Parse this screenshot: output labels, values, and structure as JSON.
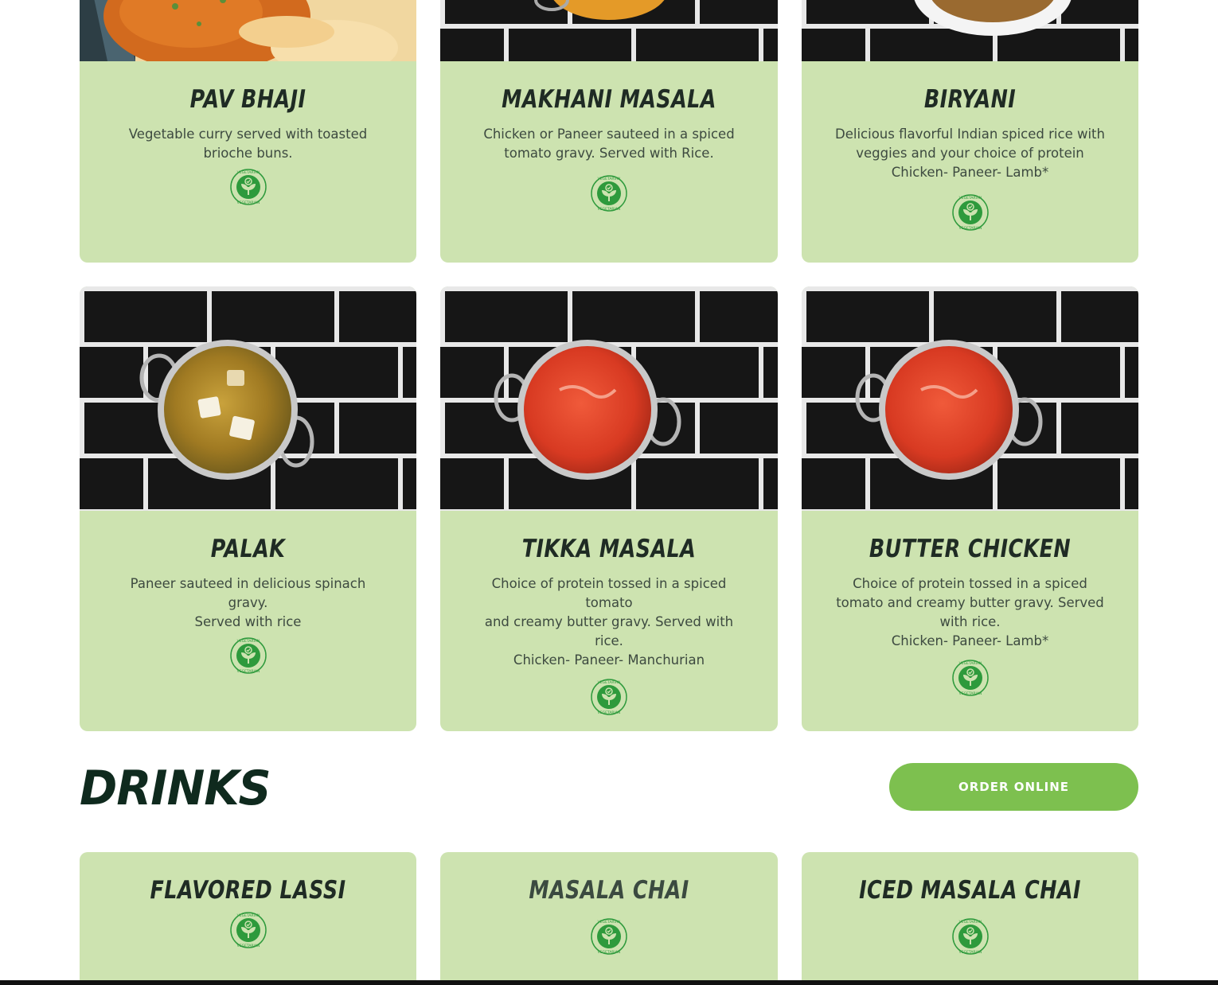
{
  "menu_items": [
    {
      "title": "PAV BHAJI",
      "desc": "Vegetable curry served with toasted\nbrioche buns.",
      "badge": "VEGETARIAN"
    },
    {
      "title": "MAKHANI MASALA",
      "desc": "Chicken or Paneer sauteed in a spiced\ntomato gravy. Served with Rice.",
      "badge": "VEGETARIAN"
    },
    {
      "title": "BIRYANI",
      "desc": "Delicious flavorful Indian spiced rice with\nveggies and your choice of protein\nChicken- Paneer- Lamb*",
      "badge": "VEGETARIAN"
    },
    {
      "title": "PALAK",
      "desc": "Paneer sauteed in delicious spinach gravy.\nServed with rice",
      "badge": "VEGETARIAN"
    },
    {
      "title": "TIKKA MASALA",
      "desc": "Choice of protein tossed in a spiced tomato\nand creamy butter gravy. Served with rice.\nChicken- Paneer- Manchurian",
      "badge": "VEGETARIAN"
    },
    {
      "title": "BUTTER CHICKEN",
      "desc": "Choice of protein tossed in a spiced\ntomato and creamy butter gravy. Served\nwith rice.\nChicken- Paneer- Lamb*",
      "badge": "VEGETARIAN"
    }
  ],
  "drinks": {
    "heading": "DRINKS",
    "order_button": "ORDER ONLINE",
    "items": [
      {
        "title": "FLAVORED LASSI",
        "badge": "VEGETARIAN"
      },
      {
        "title": "MASALA CHAI",
        "badge": "VEGETARIAN"
      },
      {
        "title": "ICED MASALA CHAI",
        "badge": "VEGETARIAN"
      }
    ]
  },
  "colors": {
    "card_bg": "#cde3b0",
    "button_bg": "#7dc04f",
    "heading": "#0f2a1e",
    "badge_green": "#2e9a3c"
  },
  "images": {
    "pav_bhaji": "curry-and-bread-photo",
    "makhani_masala": "curry-bowl-on-black-tiles-photo",
    "biryani": "rice-bowl-on-black-tiles-photo",
    "palak": "spinach-paneer-bowl-photo",
    "tikka_masala": "red-curry-bowl-photo",
    "butter_chicken": "red-curry-bowl-photo"
  }
}
